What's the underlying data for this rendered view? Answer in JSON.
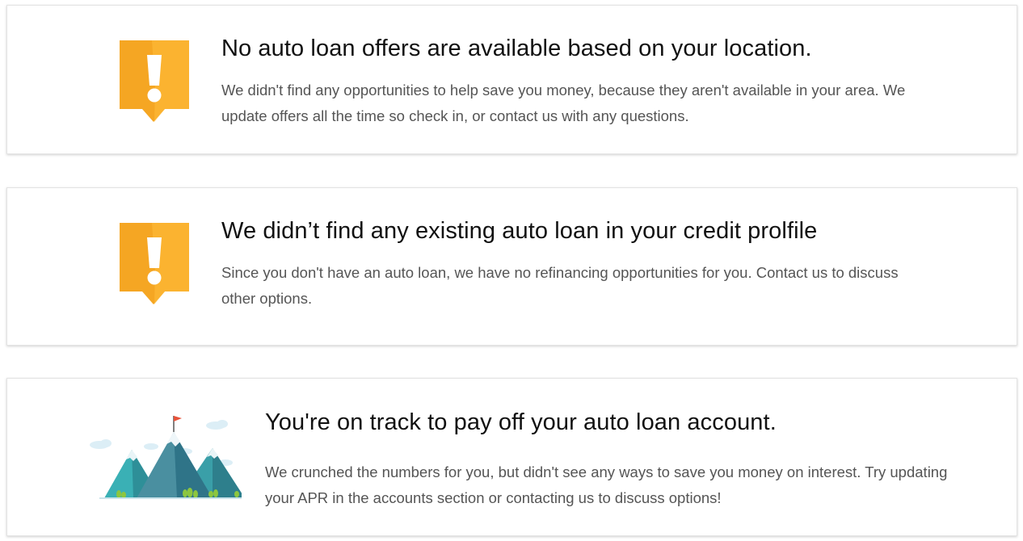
{
  "cards": [
    {
      "icon": "alert-exclamation-icon",
      "title": "No auto loan offers are available based on your location.",
      "description": "We didn't find any opportunities to help save you money, because they aren't available in your area. We update offers all the time so check in, or contact us with any questions."
    },
    {
      "icon": "alert-exclamation-icon",
      "title": "We didn’t find any existing auto loan in your credit prolfile",
      "description": "Since you don't have an auto loan, we have no refinancing opportunities for you. Contact us to discuss other options."
    },
    {
      "icon": "mountain-flag-illustration",
      "title": "You're on track to pay off your auto loan account.",
      "description": "We crunched the numbers for you, but didn't see any ways to save you money on interest. Try updating your APR in the accounts section or contacting us to discuss options!"
    }
  ],
  "colors": {
    "alert_orange": "#F5A623",
    "alert_orange_light": "#FFBE3D",
    "mountain_teal": "#3A9FA8",
    "mountain_dark": "#2E7F8C",
    "flag_red": "#E8533A",
    "cloud": "#DCEEF6",
    "tree_green": "#8CC63F"
  }
}
